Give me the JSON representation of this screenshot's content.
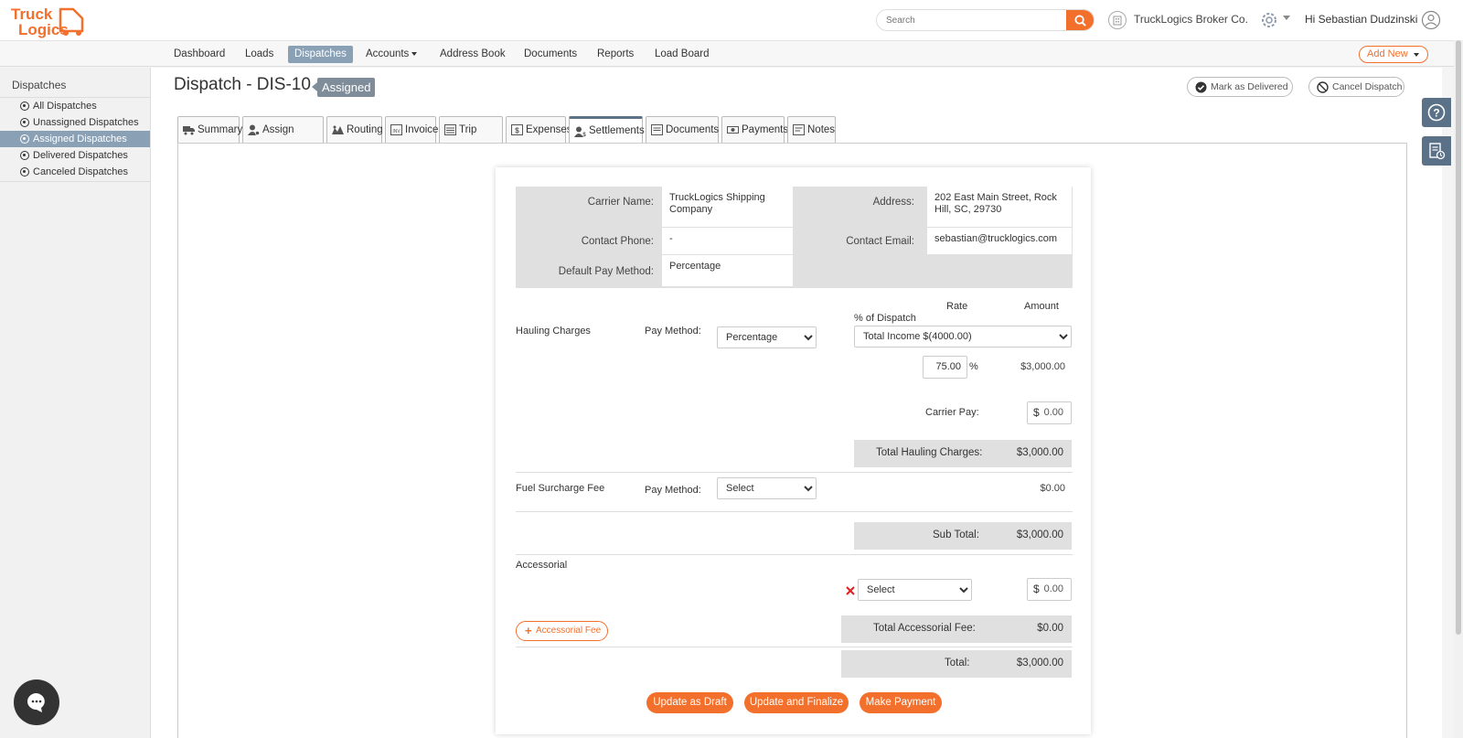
{
  "app": {
    "logo_top": "Truck",
    "logo_bottom": "Logics",
    "search_placeholder": "Search",
    "company_name": "TruckLogics Broker Co.",
    "greeting": "Hi Sebastian Dudzinski"
  },
  "nav": {
    "items": [
      "Dashboard",
      "Loads",
      "Dispatches",
      "Accounts",
      "Address Book",
      "Documents",
      "Reports",
      "Load Board"
    ],
    "active": "Dispatches",
    "add_new": "Add New"
  },
  "sidebar": {
    "title": "Dispatches",
    "items": [
      "All Dispatches",
      "Unassigned Dispatches",
      "Assigned Dispatches",
      "Delivered Dispatches",
      "Canceled Dispatches"
    ],
    "active": "Assigned Dispatches"
  },
  "page": {
    "title": "Dispatch - DIS-10",
    "status": "Assigned",
    "mark_delivered": "Mark as Delivered",
    "cancel_dispatch": "Cancel Dispatch"
  },
  "tabs": [
    "Summary",
    "Assign Carrier",
    "Routing",
    "Invoice",
    "Trip Sheet",
    "Expenses",
    "Settlements",
    "Documents",
    "Payments",
    "Notes"
  ],
  "active_tab": "Settlements",
  "carrier": {
    "name_label": "Carrier Name:",
    "name": "TruckLogics Shipping Company",
    "address_label": "Address:",
    "address": "202 East Main Street, Rock Hill, SC, 29730",
    "phone_label": "Contact Phone:",
    "phone": "-",
    "email_label": "Contact Email:",
    "email": "sebastian@trucklogics.com",
    "pay_method_label": "Default Pay Method:",
    "pay_method": "Percentage"
  },
  "settlement": {
    "rate_header": "Rate",
    "amount_header": "Amount",
    "pct_of_dispatch": "% of Dispatch",
    "hauling_label": "Hauling Charges",
    "pay_method_label": "Pay Method:",
    "hauling_pay_method": "Percentage",
    "dispatch_base": "Total Income $(4000.00)",
    "rate_value": "75.00",
    "pct_sign": "%",
    "hauling_amount": "$3,000.00",
    "carrier_pay_label": "Carrier Pay:",
    "dollar": "$",
    "carrier_pay": "0.00",
    "total_hauling_label": "Total Hauling Charges:",
    "total_hauling": "$3,000.00",
    "fuel_label": "Fuel Surcharge Fee",
    "fuel_pay_method": "Select",
    "fuel_amount": "$0.00",
    "subtotal_label": "Sub Total:",
    "subtotal": "$3,000.00",
    "accessorial_label": "Accessorial",
    "accessorial_select": "Select",
    "accessorial_amount": "0.00",
    "add_accessorial": "Accessorial Fee",
    "total_accessorial_label": "Total Accessorial Fee:",
    "total_accessorial": "$0.00",
    "total_label": "Total:",
    "total": "$3,000.00"
  },
  "actions": {
    "draft": "Update as Draft",
    "finalize": "Update and Finalize",
    "payment": "Make Payment"
  },
  "colors": {
    "brand_orange": "#f36f2c",
    "nav_active": "#8aa0b5",
    "rail_blue": "#5a7187"
  }
}
